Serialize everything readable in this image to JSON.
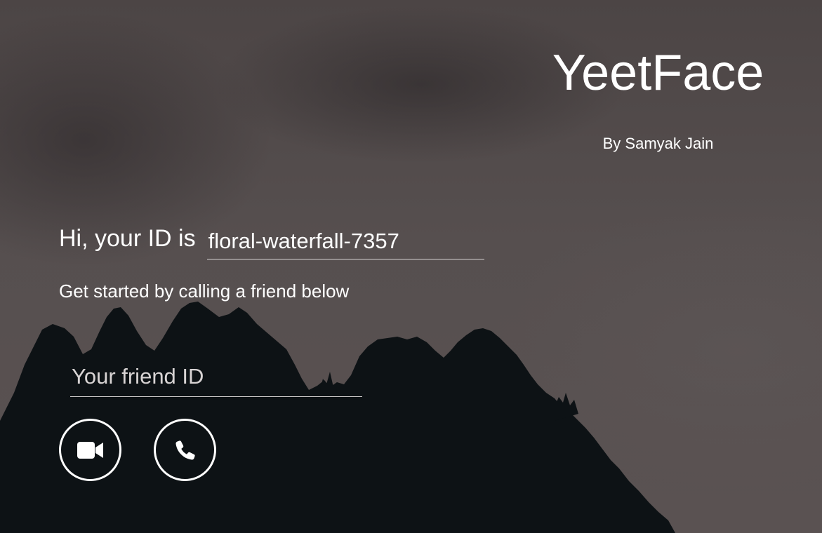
{
  "app": {
    "title": "YeetFace",
    "author": "By Samyak Jain"
  },
  "greeting": {
    "label": "Hi, your ID is",
    "my_id": "floral-waterfall-7357",
    "subtitle": "Get started by calling a friend below"
  },
  "friend": {
    "placeholder": "Your friend ID",
    "value": ""
  },
  "actions": {
    "video_icon": "video-camera-icon",
    "voice_icon": "phone-icon"
  },
  "colors": {
    "text": "#ffffff",
    "background": "#544c4c",
    "mountains": "#0d1114"
  }
}
